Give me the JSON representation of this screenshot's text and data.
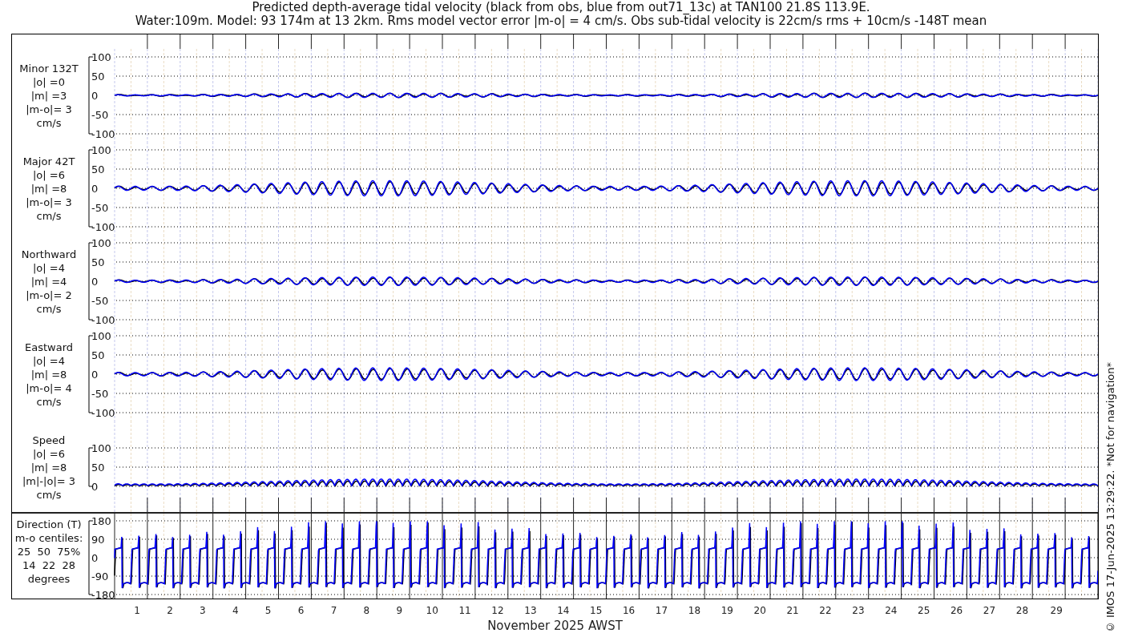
{
  "title": {
    "lines": [
      "Predicted depth-average tidal velocity (black from obs, blue from out71_13c) at TAN100 21.8S 113.9E.",
      "Water:109m. Model: 93 174m at 13 2km. Rms model vector error |m-o| = 4 cm/s. Obs sub-tidal velocity is 22cm/s rms + 10cm/s -148T mean"
    ]
  },
  "panels": [
    {
      "kind": "velocity",
      "label_lines": [
        "Minor 132T",
        "|o| =0",
        "|m| =3",
        "|m-o|= 3",
        "cm/s"
      ],
      "yticks": [
        "100",
        "50",
        "0",
        "-50",
        "-100"
      ]
    },
    {
      "kind": "velocity",
      "label_lines": [
        "Major 42T",
        "|o| =6",
        "|m| =8",
        "|m-o|= 3",
        "cm/s"
      ],
      "yticks": [
        "100",
        "50",
        "0",
        "-50",
        "-100"
      ]
    },
    {
      "kind": "velocity",
      "label_lines": [
        "Northward",
        "|o| =4",
        "|m| =4",
        "|m-o|= 2",
        "cm/s"
      ],
      "yticks": [
        "100",
        "50",
        "0",
        "-50",
        "-100"
      ]
    },
    {
      "kind": "velocity",
      "label_lines": [
        "Eastward",
        "|o| =4",
        "|m| =8",
        "|m-o|= 4",
        "cm/s"
      ],
      "yticks": [
        "100",
        "50",
        "0",
        "-50",
        "-100"
      ]
    },
    {
      "kind": "speed",
      "label_lines": [
        "Speed",
        "|o| =6",
        "|m| =8",
        "|m|-|o|= 3",
        "cm/s"
      ],
      "yticks": [
        "100",
        "50",
        "0"
      ]
    }
  ],
  "direction_panel": {
    "label_lines": [
      "Direction (T)",
      "m-o centiles:",
      "25  50  75%",
      "14  22  28",
      "degrees"
    ],
    "yticks": [
      "180",
      "90",
      "0",
      "-90",
      "-180"
    ]
  },
  "x_axis": {
    "tick_labels": "1 2 3 4 5 6 7 8 9 10 11 12 13 14 15 16 17 18 19 20 21 22 23 24 25 26 27 28 29",
    "label": "November 2025 AWST"
  },
  "footer": "© IMOS 17-Jun-2025 13:29:22. *Not for navigation*"
}
